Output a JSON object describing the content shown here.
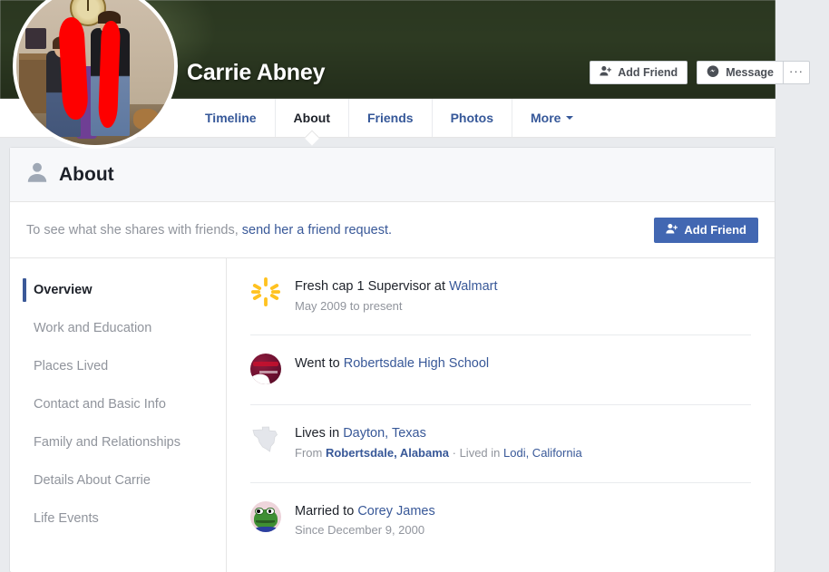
{
  "profile": {
    "name": "Carrie Abney",
    "avatar_alt": "profile-photo-redacted",
    "actions": {
      "add_friend": "Add Friend",
      "message": "Message",
      "more": "···"
    }
  },
  "nav": {
    "tabs": [
      {
        "label": "Timeline",
        "active": false
      },
      {
        "label": "About",
        "active": true
      },
      {
        "label": "Friends",
        "active": false
      },
      {
        "label": "Photos",
        "active": false
      },
      {
        "label": "More",
        "active": false,
        "has_caret": true
      }
    ]
  },
  "about": {
    "title": "About",
    "notice_prefix": "To see what she shares with friends, ",
    "notice_link": "send her a friend request.",
    "add_friend_label": "Add Friend"
  },
  "sidebar": {
    "items": [
      {
        "label": "Overview",
        "active": true
      },
      {
        "label": "Work and Education",
        "active": false
      },
      {
        "label": "Places Lived",
        "active": false
      },
      {
        "label": "Contact and Basic Info",
        "active": false
      },
      {
        "label": "Family and Relationships",
        "active": false
      },
      {
        "label": "Details About Carrie",
        "active": false
      },
      {
        "label": "Life Events",
        "active": false
      }
    ]
  },
  "overview": {
    "work": {
      "icon": "walmart-spark-icon",
      "prefix": "Fresh cap 1 Supervisor at ",
      "link": "Walmart",
      "sub": "May 2009 to present"
    },
    "education": {
      "icon": "school-logo-icon",
      "prefix": "Went to ",
      "link": "Robertsdale High School"
    },
    "places": {
      "icon": "texas-state-icon",
      "prefix": "Lives in ",
      "link": "Dayton, Texas",
      "sub_from_label": "From ",
      "sub_from_place": "Robertsdale, Alabama",
      "sub_separator": " · ",
      "sub_lived_label": "Lived in ",
      "sub_lived_place": "Lodi, California"
    },
    "relationship": {
      "icon": "partner-avatar-icon",
      "prefix": "Married to ",
      "link": "Corey James",
      "sub": "Since December 9, 2000"
    }
  },
  "colors": {
    "fb_blue": "#4267b2",
    "link_blue": "#385898",
    "active_bar": "#3b5998",
    "muted_text": "#90949c",
    "page_bg": "#e9ebee",
    "walmart_yellow": "#ffc220",
    "redaction_red": "#fe0000"
  }
}
